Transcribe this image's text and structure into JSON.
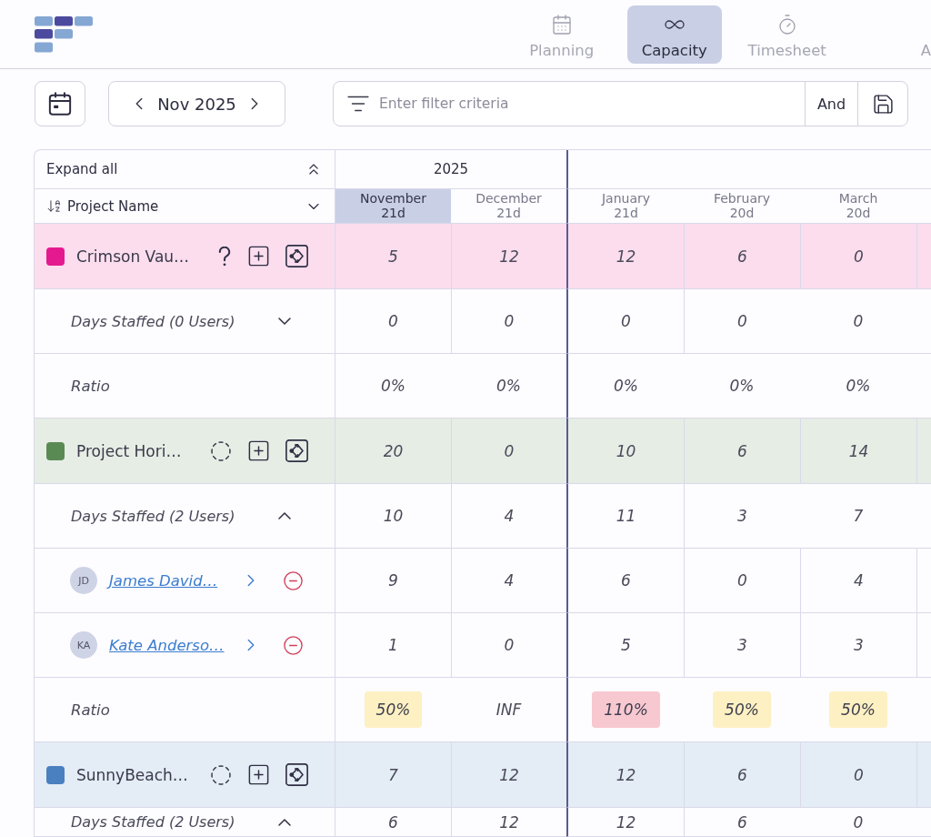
{
  "header": {
    "nav_tabs": [
      {
        "label": "Planning",
        "selected": false
      },
      {
        "label": "Capacity",
        "selected": true
      },
      {
        "label": "Timesheet",
        "selected": false
      },
      {
        "label": "A",
        "selected": false
      }
    ]
  },
  "toolbar": {
    "period": "Nov 2025",
    "filter": {
      "placeholder": "Enter filter criteria",
      "operator": "And"
    }
  },
  "table": {
    "expand_label": "Expand all",
    "name_column": "Project Name",
    "years": [
      {
        "label": "2025",
        "months": [
          {
            "name": "November",
            "days": "21d",
            "selected": true
          },
          {
            "name": "December",
            "days": "21d",
            "selected": false
          }
        ]
      },
      {
        "months": [
          {
            "name": "January",
            "days": "21d",
            "selected": false
          },
          {
            "name": "February",
            "days": "20d",
            "selected": false
          },
          {
            "name": "March",
            "days": "20d",
            "selected": false
          }
        ]
      }
    ],
    "projects": [
      {
        "name": "Crimson Vau…",
        "color": "#e5198f",
        "loading": false,
        "values": [
          "5",
          "12",
          "12",
          "6",
          "0"
        ],
        "days": {
          "label": "Days Staffed (0 Users)",
          "expanded": false,
          "values": [
            "0",
            "0",
            "0",
            "0",
            "0"
          ]
        },
        "ratio": {
          "label": "Ratio",
          "values": [
            {
              "text": "0%"
            },
            {
              "text": "0%"
            },
            {
              "text": "0%"
            },
            {
              "text": "0%"
            },
            {
              "text": "0%"
            }
          ]
        }
      },
      {
        "name": "Project Hori…",
        "color": "#5a8a54",
        "loading": true,
        "values": [
          "20",
          "0",
          "10",
          "6",
          "14"
        ],
        "days": {
          "label": "Days Staffed (2 Users)",
          "expanded": true,
          "values": [
            "10",
            "4",
            "11",
            "3",
            "7"
          ],
          "users": [
            {
              "initials": "JD",
              "name": "James David…",
              "values": [
                "9",
                "4",
                "6",
                "0",
                "4"
              ]
            },
            {
              "initials": "KA",
              "name": "Kate Anderso…",
              "values": [
                "1",
                "0",
                "5",
                "3",
                "3"
              ]
            }
          ]
        },
        "ratio": {
          "label": "Ratio",
          "values": [
            {
              "text": "50%",
              "color": "#fdf0c2"
            },
            {
              "text": "INF"
            },
            {
              "text": "110%",
              "color": "#f8c8d1"
            },
            {
              "text": "50%",
              "color": "#fdf0c2"
            },
            {
              "text": "50%",
              "color": "#fdf0c2"
            }
          ]
        }
      },
      {
        "name": "SunnyBeach…",
        "color": "#4a7fc0",
        "loading": true,
        "values": [
          "7",
          "12",
          "12",
          "6",
          "0"
        ],
        "days": {
          "label": "Days Staffed (2 Users)",
          "expanded": true,
          "values": [
            "6",
            "12",
            "12",
            "6",
            "0"
          ]
        }
      }
    ]
  }
}
